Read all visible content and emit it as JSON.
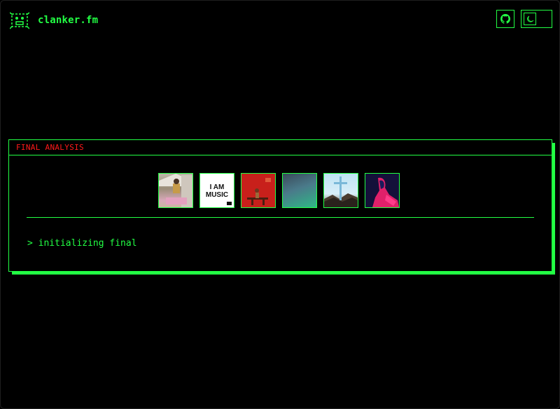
{
  "header": {
    "brand_name": "clanker.fm",
    "logo_icon": "robot-face-icon",
    "github_icon": "github-icon",
    "theme_icon": "moon-icon"
  },
  "panel": {
    "title": "FINAL ANALYSIS",
    "albums": [
      {
        "icon": "album-cover-1",
        "text": ""
      },
      {
        "icon": "album-cover-i-am-music",
        "text": "I AM MUSIC"
      },
      {
        "icon": "album-cover-3",
        "text": ""
      },
      {
        "icon": "album-cover-4",
        "text": ""
      },
      {
        "icon": "album-cover-cross",
        "text": ""
      },
      {
        "icon": "album-cover-6",
        "text": ""
      }
    ],
    "terminal_line": "> initializing final"
  },
  "colors": {
    "accent": "#22ff44",
    "title_red": "#ff1a1a",
    "background": "#000000"
  }
}
